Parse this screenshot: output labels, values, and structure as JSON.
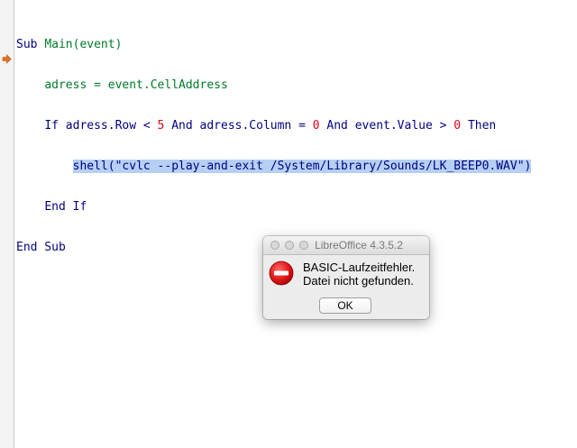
{
  "editor": {
    "lines": [
      {
        "t1": "Sub ",
        "t2": "Main(event)"
      },
      {
        "indent": "    ",
        "t1": "adress = event.CellAddress"
      },
      {
        "indent": "    ",
        "p1": "If adress.Row < ",
        "n1": "5",
        "p2": " And adress.Column = ",
        "n2": "0",
        "p3": " And event.Value > ",
        "n3": "0",
        "p4": " Then"
      },
      {
        "indent": "        ",
        "t1": "shell(\"cvlc --play-and-exit /System/Library/Sounds/LK_BEEP0.WAV\")"
      },
      {
        "indent": "    ",
        "t1": "End If"
      },
      {
        "t1": "End Sub"
      }
    ],
    "current_line_marker_icon": "arrow-right-icon",
    "marker_color": "#e8711f",
    "highlight_color": "#b5d0f4"
  },
  "dialog": {
    "title": "LibreOffice 4.3.5.2",
    "icon": "stop-icon",
    "message_line1": "BASIC-Laufzeitfehler.",
    "message_line2": "Datei nicht gefunden.",
    "ok_label": "OK"
  }
}
